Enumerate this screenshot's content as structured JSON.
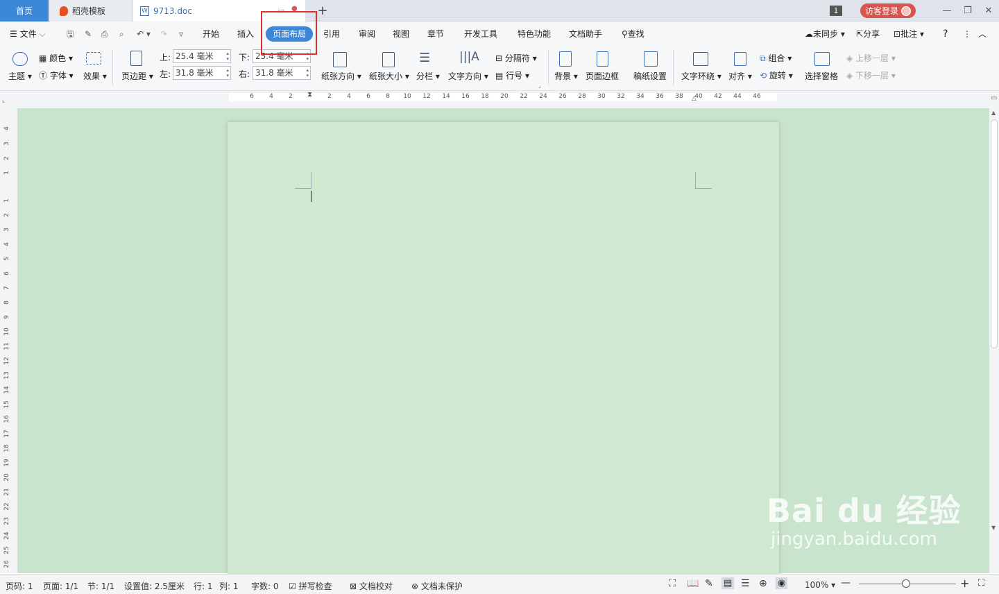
{
  "titlebar": {
    "tabs": [
      {
        "label": "首页"
      },
      {
        "label": "稻壳模板"
      },
      {
        "label": "9713.doc"
      }
    ],
    "add_tab": "+",
    "window_count": "1",
    "login_label": "访客登录"
  },
  "menubar": {
    "file": "文件",
    "tabs": [
      "开始",
      "插入",
      "页面布局",
      "引用",
      "审阅",
      "视图",
      "章节",
      "开发工具",
      "特色功能",
      "文档助手"
    ],
    "search": "查找",
    "sync": "未同步",
    "share": "分享",
    "comment": "批注",
    "help": "?"
  },
  "ribbon": {
    "theme": "主题",
    "color": "颜色",
    "font": "字体",
    "effect": "效果",
    "margins": "页边距",
    "top_label": "上:",
    "top_value": "25.4 毫米",
    "bottom_label": "下:",
    "bottom_value": "25.4 毫米",
    "left_label": "左:",
    "left_value": "31.8 毫米",
    "right_label": "右:",
    "right_value": "31.8 毫米",
    "orientation": "纸张方向",
    "size": "纸张大小",
    "columns": "分栏",
    "text_direction": "文字方向",
    "breaks": "分隔符",
    "line_numbers": "行号",
    "background": "背景",
    "page_border": "页面边框",
    "manuscript": "稿纸设置",
    "wrap": "文字环绕",
    "align": "对齐",
    "group": "组合",
    "rotate": "旋转",
    "selection_pane": "选择窗格",
    "bring_forward": "上移一层",
    "send_backward": "下移一层"
  },
  "ruler": {
    "h_ticks": [
      "6",
      "4",
      "2",
      "2",
      "4",
      "6",
      "8",
      "10",
      "12",
      "14",
      "16",
      "18",
      "20",
      "22",
      "24",
      "26",
      "28",
      "30",
      "32",
      "34",
      "36",
      "38",
      "40",
      "42",
      "44",
      "46"
    ],
    "v_ticks": [
      "4",
      "3",
      "2",
      "1",
      "1",
      "2",
      "3",
      "4",
      "5",
      "6",
      "7",
      "8",
      "9",
      "10",
      "11",
      "12",
      "13",
      "14",
      "15",
      "16",
      "17",
      "18",
      "19",
      "20",
      "21",
      "22",
      "23",
      "24",
      "25",
      "26"
    ]
  },
  "status": {
    "page_no": "页码: 1",
    "pages": "页面: 1/1",
    "section": "节: 1/1",
    "setting": "设置值: 2.5厘米",
    "row": "行: 1",
    "col": "列: 1",
    "words": "字数: 0",
    "spell": "拼写检查",
    "proof": "文档校对",
    "protect": "文档未保护",
    "zoom": "100%"
  },
  "watermark": {
    "main": "Bai du 经验",
    "sub": "jingyan.baidu.com"
  },
  "colors": {
    "accent": "#3c87d7",
    "page_bg": "#cfe8cf",
    "canvas_bg": "#c9e4cc",
    "highlight": "#e0302c",
    "login_bg": "#d9534f"
  }
}
